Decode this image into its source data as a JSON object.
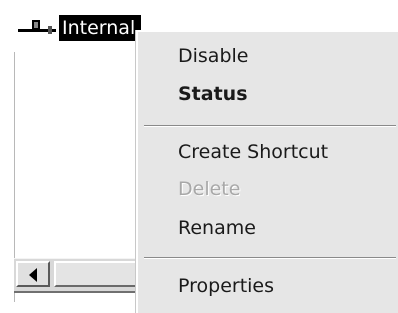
{
  "network_item": {
    "label": "Internal",
    "icon": "network-connection-icon",
    "selected": true
  },
  "context_menu": {
    "items": [
      {
        "label": "Disable",
        "state": "enabled"
      },
      {
        "label": "Status",
        "state": "default"
      },
      {
        "label": "Create Shortcut",
        "state": "enabled"
      },
      {
        "label": "Delete",
        "state": "disabled"
      },
      {
        "label": "Rename",
        "state": "enabled"
      },
      {
        "label": "Properties",
        "state": "enabled"
      }
    ]
  },
  "scrollbar": {
    "left_arrow_icon": "arrow-left-icon"
  },
  "colors": {
    "selection_bg": "#000000",
    "menu_bg": "#e6e6e6",
    "disabled_text": "#a8a8a8"
  }
}
